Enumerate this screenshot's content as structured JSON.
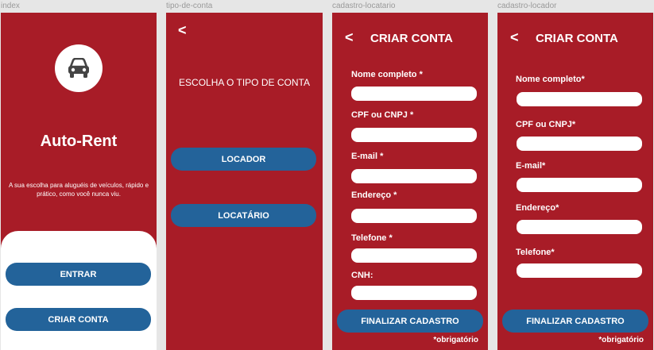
{
  "frames": {
    "index": "index",
    "tipo": "tipo-de-conta",
    "locatario": "cadastro-locatario",
    "locador": "cadastro-locador"
  },
  "index": {
    "app_name": "Auto-Rent",
    "tagline": "A sua escolha para aluguéis de veículos, rápido e prático, como você nunca viu.",
    "enter_button": "ENTRAR",
    "create_button": "CRIAR CONTA",
    "logo_icon": "car-icon"
  },
  "tipo": {
    "back": "<",
    "heading": "ESCOLHA O TIPO DE CONTA",
    "locador_button": "LOCADOR",
    "locatario_button": "LOCATÁRIO"
  },
  "locatario": {
    "back": "<",
    "title": "CRIAR CONTA",
    "fields": [
      "Nome completo *",
      "CPF ou CNPJ *",
      "E-mail *",
      "Endereço *",
      "Telefone *",
      "CNH:"
    ],
    "submit": "FINALIZAR CADASTRO",
    "required_note": "*obrigatório"
  },
  "locador": {
    "back": "<",
    "title": "CRIAR CONTA",
    "fields": [
      "Nome completo*",
      "CPF ou CNPJ*",
      "E-mail*",
      "Endereço*",
      "Telefone*"
    ],
    "submit": "FINALIZAR CADASTRO",
    "required_note": "*obrigatório"
  },
  "colors": {
    "primary_red": "#a81c27",
    "button_blue": "#23639a",
    "white": "#ffffff"
  }
}
